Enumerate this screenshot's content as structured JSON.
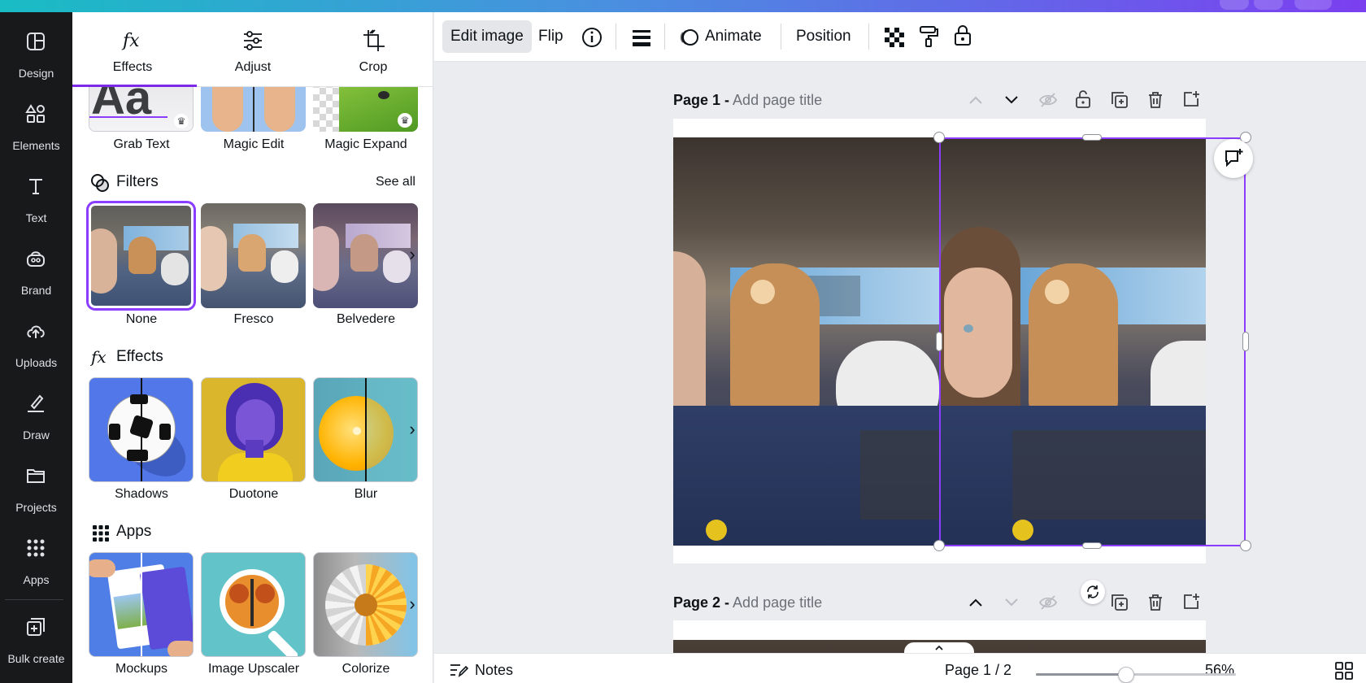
{
  "rail": {
    "items": [
      {
        "label": "Design",
        "icon": "design-icon"
      },
      {
        "label": "Elements",
        "icon": "elements-icon"
      },
      {
        "label": "Text",
        "icon": "text-icon"
      },
      {
        "label": "Brand",
        "icon": "brand-icon"
      },
      {
        "label": "Uploads",
        "icon": "uploads-icon"
      },
      {
        "label": "Draw",
        "icon": "draw-icon"
      },
      {
        "label": "Projects",
        "icon": "projects-icon"
      },
      {
        "label": "Apps",
        "icon": "apps-icon"
      }
    ],
    "bulk_create": "Bulk create"
  },
  "panel": {
    "tabs": [
      {
        "label": "Effects",
        "icon": "fx-icon"
      },
      {
        "label": "Adjust",
        "icon": "sliders-icon"
      },
      {
        "label": "Crop",
        "icon": "crop-icon"
      }
    ],
    "tools": [
      "Grab Text",
      "Magic Edit",
      "Magic Expand"
    ],
    "filters": {
      "title": "Filters",
      "see_all": "See all",
      "items": [
        "None",
        "Fresco",
        "Belvedere"
      ]
    },
    "effects": {
      "title": "Effects",
      "items": [
        "Shadows",
        "Duotone",
        "Blur"
      ]
    },
    "apps": {
      "title": "Apps",
      "items": [
        "Mockups",
        "Image Upscaler",
        "Colorize"
      ]
    }
  },
  "toolbar": {
    "edit_image": "Edit image",
    "flip": "Flip",
    "animate": "Animate",
    "position": "Position"
  },
  "pages": [
    {
      "label": "Page 1 -",
      "title_placeholder": "Add page title"
    },
    {
      "label": "Page 2 -",
      "title_placeholder": "Add page title"
    }
  ],
  "bottombar": {
    "notes": "Notes",
    "page_indicator": "Page 1 / 2",
    "zoom": "56%",
    "zoom_fraction": 0.45
  },
  "colors": {
    "accent": "#8b3dff",
    "rail_bg": "#18191b"
  }
}
